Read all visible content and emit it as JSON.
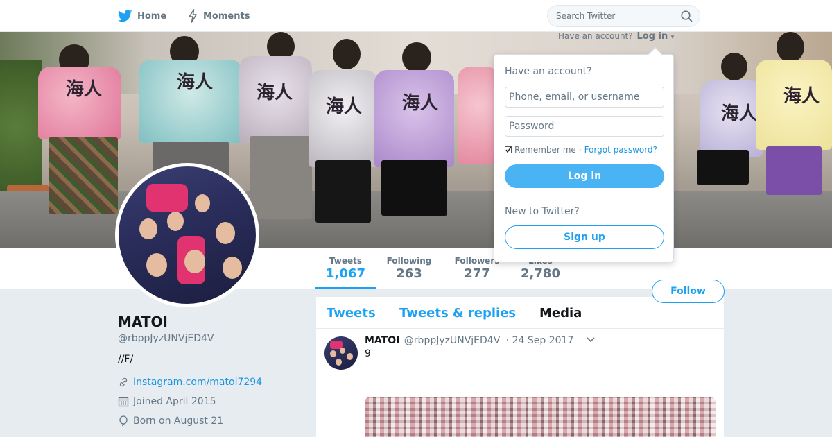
{
  "nav": {
    "home_label": "Home",
    "moments_label": "Moments",
    "search_placeholder": "Search Twitter"
  },
  "login_prompt": {
    "have_account_text": "Have an account?",
    "login_link": "Log in"
  },
  "login_dropdown": {
    "title": "Have an account?",
    "username_placeholder": "Phone, email, or username",
    "password_placeholder": "Password",
    "remember_label": "Remember me",
    "separator": "·",
    "forgot_label": "Forgot password?",
    "login_button": "Log in",
    "new_to_twitter": "New to Twitter?",
    "signup_button": "Sign up"
  },
  "banner": {
    "shirt_text": "海人"
  },
  "stats": {
    "tweets": {
      "label": "Tweets",
      "value": "1,067"
    },
    "following": {
      "label": "Following",
      "value": "263"
    },
    "followers": {
      "label": "Followers",
      "value": "277"
    },
    "likes": {
      "label": "Likes",
      "value": "2,780"
    }
  },
  "follow_button": "Follow",
  "profile": {
    "name": "MATOI",
    "handle": "@rbppJyzUNVjED4V",
    "bio": "//F/",
    "link": "Instagram.com/matoi7294",
    "joined": "Joined April 2015",
    "born": "Born on August 21"
  },
  "timeline": {
    "tabs": [
      "Tweets",
      "Tweets & replies",
      "Media"
    ],
    "active_tab": "Media",
    "tweet": {
      "name": "MATOI",
      "handle": "@rbppJyzUNVjED4V",
      "date": "· 24 Sep 2017",
      "text": "9"
    }
  },
  "colors": {
    "accent": "#1da1f2",
    "link": "#1b95e0",
    "background": "#e6ecf0",
    "secondary_text": "#657786"
  },
  "icons": {
    "nav_home": "twitter-bird-icon",
    "nav_moments": "lightning-icon",
    "search": "search-icon",
    "link": "link-icon",
    "joined": "calendar-icon",
    "born": "balloon-icon",
    "tweet_menu": "chevron-down-icon"
  }
}
